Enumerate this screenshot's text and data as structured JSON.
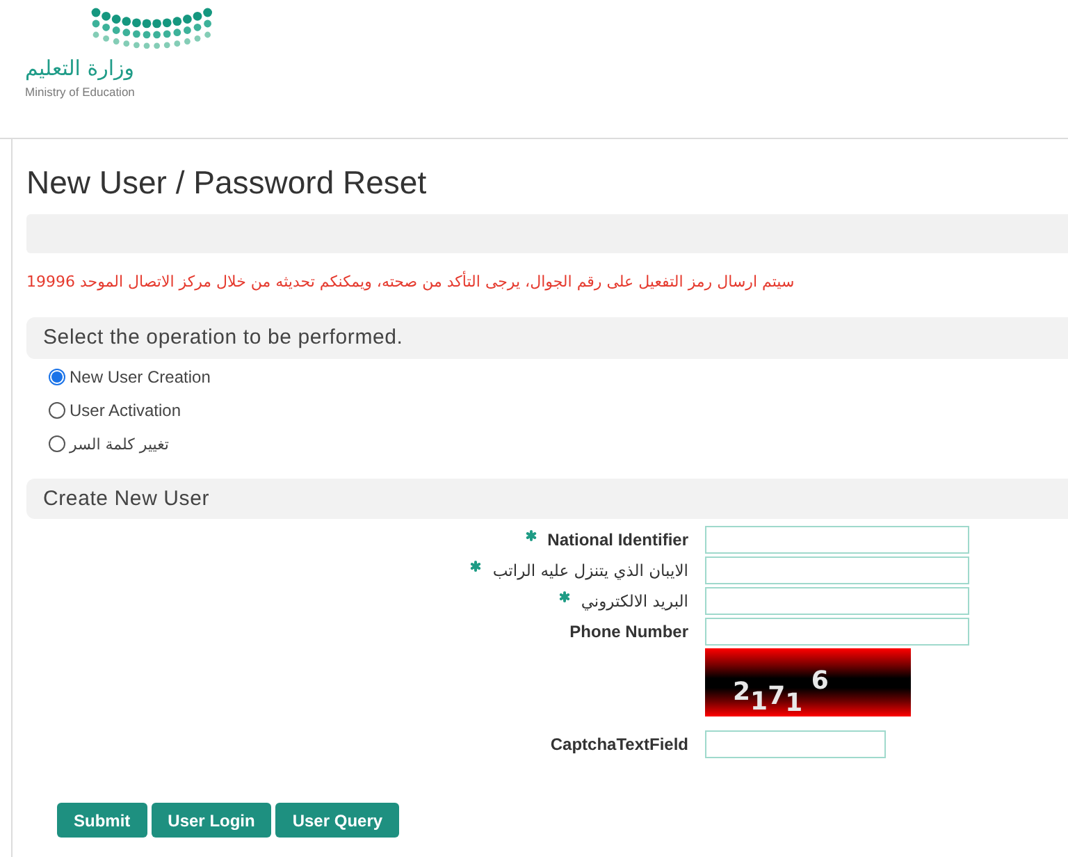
{
  "header": {
    "logo": {
      "name_ar": "وزارة التعليم",
      "name_en": "Ministry of Education"
    }
  },
  "page": {
    "title": "New User / Password Reset",
    "notice": "سيتم ارسال رمز التفعيل على رقم الجوال، يرجى التأكد من صحته، ويمكنكم تحديثه من خلال مركز الاتصال الموحد 19996"
  },
  "operation_section": {
    "heading": "Select the operation to be performed.",
    "options": [
      {
        "label": "New User Creation",
        "selected": true
      },
      {
        "label": "User Activation",
        "selected": false
      },
      {
        "label": "تغيير كلمة السر",
        "selected": false
      }
    ]
  },
  "form_section": {
    "heading": "Create New User",
    "fields": [
      {
        "kind": "text",
        "label": "National Identifier",
        "required": true
      },
      {
        "kind": "text",
        "label": "الايبان الذي يتنزل عليه الراتب",
        "required": true
      },
      {
        "kind": "text",
        "label": "البريد الالكتروني",
        "required": true
      },
      {
        "kind": "text",
        "label": "Phone Number",
        "required": false
      },
      {
        "kind": "captcha_image",
        "text": "2171 6"
      },
      {
        "kind": "captcha_text",
        "label": "CaptchaTextField",
        "required": false
      }
    ]
  },
  "buttons": [
    "Submit",
    "User Login",
    "User Query"
  ]
}
